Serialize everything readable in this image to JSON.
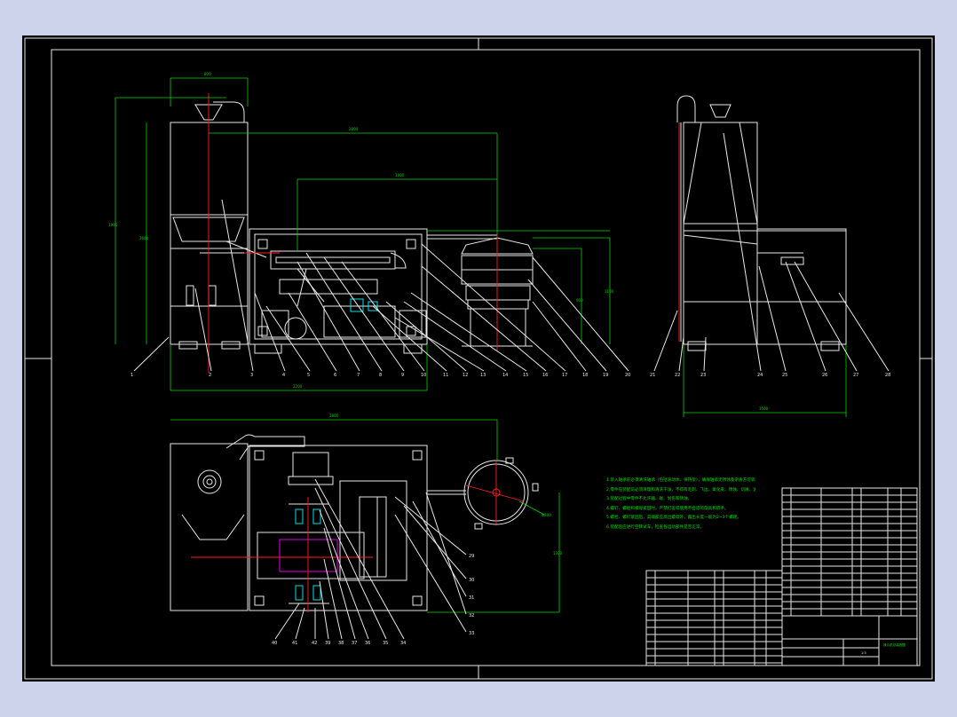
{
  "notes": [
    "1.装入轴承前必须清洗轴承（包括滚动体、保持架），确保轴承无锈蚀及杂质方可装配使用。",
    "2.零件在装配前必须清理和清洗干净，不得有毛刺、飞边、氧化皮、锈蚀、切屑、油污、着色剂和灰尘等。",
    "3.装配过程中零件不允许磕、碰、划伤和锈蚀。",
    "4.螺钉、螺栓和螺母紧固时，严禁打击或使用不合适的旋具和扳手。",
    "5.螺栓、螺钉紧固后，其端部应高出螺母外，露出长度一般为2~3个螺距。",
    "6.装配后应进行空转试车，检查各运动部件是否正常。"
  ],
  "part_labels_front": [
    "1",
    "2",
    "3",
    "4",
    "5",
    "6",
    "7",
    "8",
    "9",
    "10",
    "11",
    "12",
    "13",
    "14",
    "15",
    "16",
    "17",
    "18",
    "19",
    "20"
  ],
  "part_labels_side": [
    "21",
    "22",
    "23",
    "24",
    "25",
    "26",
    "27",
    "28"
  ],
  "part_labels_top_right": [
    "29",
    "30",
    "31",
    "32",
    "33"
  ],
  "part_labels_top_bottom": [
    "40",
    "41",
    "42",
    "39",
    "38",
    "37",
    "36",
    "35",
    "34"
  ],
  "title_block": {
    "drawing_name": "揉丸机总装配图",
    "scale": "1:5"
  },
  "colors": {
    "background": "#cdd3ea",
    "sheet": "#000000",
    "outline": "#e8e8e8",
    "dimension": "#00d400",
    "centerline": "#ff2020",
    "highlight": "#00e0e0",
    "section": "#e000e0"
  }
}
